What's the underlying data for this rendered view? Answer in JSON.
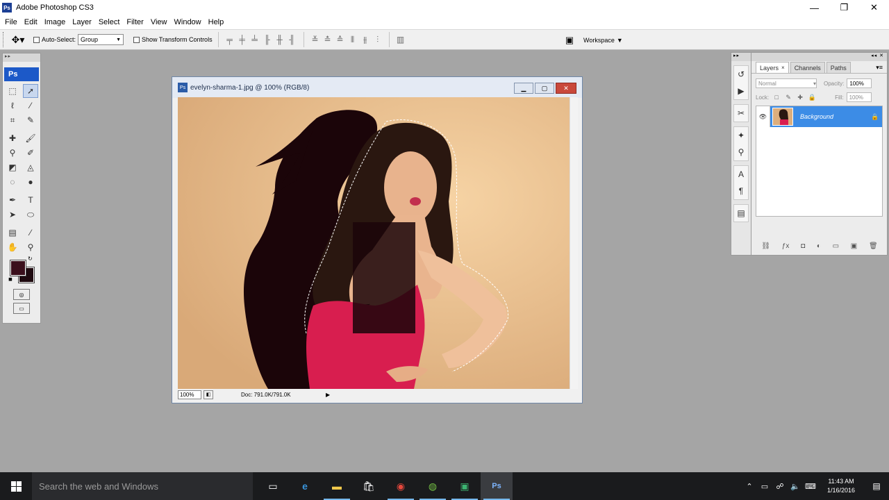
{
  "app": {
    "title": "Adobe Photoshop CS3",
    "logo": "Ps"
  },
  "window_controls": {
    "minimize": "—",
    "restore": "❐",
    "close": "✕"
  },
  "menu": [
    "File",
    "Edit",
    "Image",
    "Layer",
    "Select",
    "Filter",
    "View",
    "Window",
    "Help"
  ],
  "options_bar": {
    "auto_select_label": "Auto-Select:",
    "auto_select_value": "Group",
    "show_transform_label": "Show Transform Controls",
    "workspace_label": "Workspace"
  },
  "tools": {
    "header": "Ps",
    "foreground_color": "#3a0f1c",
    "background_color": "#1f0a10"
  },
  "document": {
    "title": "evelyn-sharma-1.jpg @ 100% (RGB/8)",
    "zoom": "100%",
    "doc_size": "Doc: 791.0K/791.0K"
  },
  "layers_panel": {
    "tabs": [
      {
        "label": "Layers",
        "active": true
      },
      {
        "label": "Channels",
        "active": false
      },
      {
        "label": "Paths",
        "active": false
      }
    ],
    "blend_mode": "Normal",
    "opacity_label": "Opacity:",
    "opacity_value": "100%",
    "lock_label": "Lock:",
    "fill_label": "Fill:",
    "fill_value": "100%",
    "layers": [
      {
        "name": "Background",
        "visible": true,
        "locked": true,
        "selected": true
      }
    ]
  },
  "taskbar": {
    "search_placeholder": "Search the web and Windows",
    "time": "11:43 AM",
    "date": "1/16/2016"
  },
  "colors": {
    "canvas_background": "#e8c08e",
    "dress": "#d81e4f",
    "selection_highlight": "#3c8ce6"
  }
}
